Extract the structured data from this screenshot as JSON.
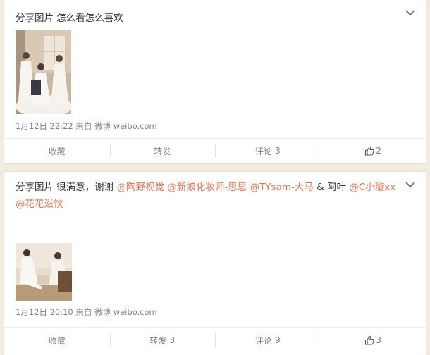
{
  "posts": [
    {
      "text": "分享图片 怎么看怎么喜欢",
      "time": "1月12日 22:22",
      "via": "来自",
      "source": "微博 weibo.com",
      "actions": {
        "favorite": "收藏",
        "repost": "转发",
        "repost_count": "",
        "comment": "评论",
        "comment_count": "3",
        "like_count": "2"
      }
    },
    {
      "text_prefix": "分享图片 很满意，谢谢",
      "mentions": [
        "@陶野视觉",
        "@新娘化妆师-思思",
        "@TYsam-大马",
        "@C小璇xx",
        "@花花滋饮"
      ],
      "text_connector": "& 阿叶",
      "time": "1月12日 20:10",
      "via": "来自",
      "source": "微博 weibo.com",
      "actions": {
        "favorite": "收藏",
        "repost": "转发",
        "repost_count": "3",
        "comment": "评论",
        "comment_count": "9",
        "like_count": "3"
      }
    }
  ],
  "colors": {
    "background": "#f2ebe0",
    "mention": "#eb7350",
    "meta": "#808080"
  },
  "icons": {
    "more": "chevron-down-icon",
    "like": "thumbs-up-icon"
  }
}
